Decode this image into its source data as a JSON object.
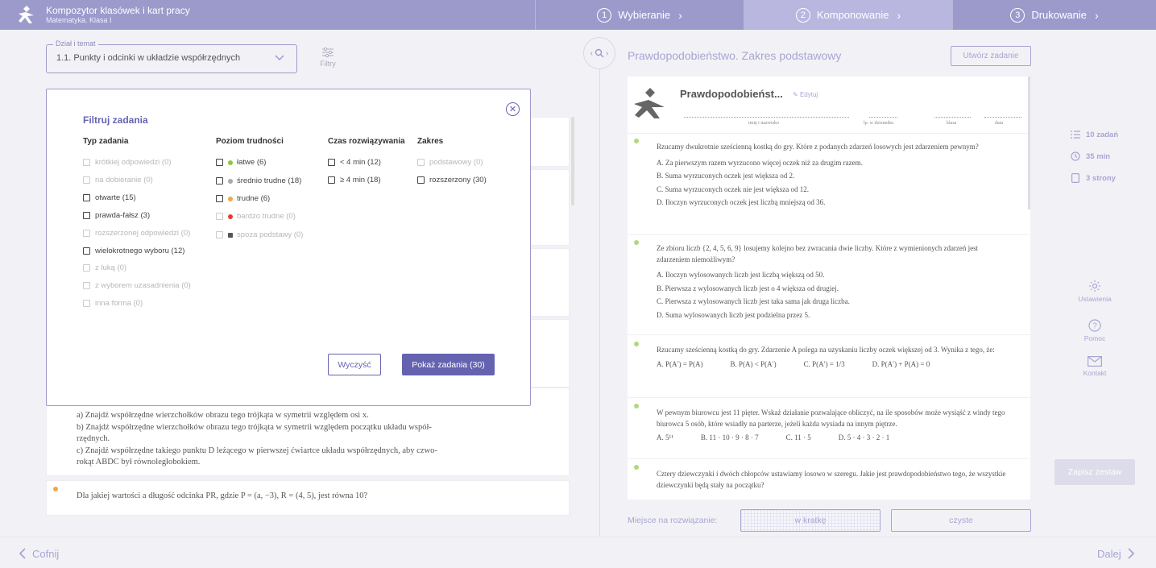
{
  "header": {
    "app_title": "Kompozytor klasówek i kart pracy",
    "app_subtitle": "Matematyka. Klasa I",
    "steps": [
      {
        "num": "1",
        "label": "Wybieranie",
        "active": false
      },
      {
        "num": "2",
        "label": "Komponowanie",
        "active": true
      },
      {
        "num": "3",
        "label": "Drukowanie",
        "active": false
      }
    ]
  },
  "topic": {
    "legend": "Dział i temat",
    "value": "1.1. Punkty i odcinki w układzie współrzędnych",
    "filters_label": "Filtry"
  },
  "tasks_behind": {
    "lines": [
      "a)  Znajdź współrzędne wierzchołków obrazu tego trójkąta w symetrii względem osi x.",
      "b)  Znajdź współrzędne wierzchołków obrazu tego trójkąta w symetrii względem początku układu współ-",
      "rzędnych.",
      "c)  Znajdź współrzędne takiego punktu D leżącego w pierwszej ćwiartce układu współrzędnych, aby czwo-",
      "rokąt ABDC był równoległobokiem."
    ],
    "next_task": "Dla jakiej wartości a długość odcinka PR, gdzie P = (a, −3), R = (4, 5), jest równa 10?"
  },
  "filter_modal": {
    "title": "Filtruj zadania",
    "columns": [
      {
        "head": "Typ zadania",
        "options": [
          {
            "label": "krótkiej odpowiedzi (0)",
            "enabled": false
          },
          {
            "label": "na dobieranie (0)",
            "enabled": false
          },
          {
            "label": "otwarte (15)",
            "enabled": true
          },
          {
            "label": "prawda-fałsz (3)",
            "enabled": true
          },
          {
            "label": "rozszerzonej odpowiedzi (0)",
            "enabled": false
          },
          {
            "label": "wielokrotnego wyboru (12)",
            "enabled": true
          },
          {
            "label": "z luką (0)",
            "enabled": false
          },
          {
            "label": "z wyborem uzasadnienia (0)",
            "enabled": false
          },
          {
            "label": "inna forma (0)",
            "enabled": false
          }
        ]
      },
      {
        "head": "Poziom trudności",
        "options": [
          {
            "label": "łatwe (6)",
            "enabled": true,
            "color": "#8dc63f"
          },
          {
            "label": "średnio trudne (18)",
            "enabled": true,
            "color": "#a9a9a9"
          },
          {
            "label": "trudne (6)",
            "enabled": true,
            "color": "#f5a742"
          },
          {
            "label": "bardzo trudne (0)",
            "enabled": false,
            "color": "#e53935"
          },
          {
            "label": "spoza podstawy (0)",
            "enabled": false,
            "color": "#555555"
          }
        ]
      },
      {
        "head": "Czas rozwiązywania",
        "options": [
          {
            "label": "< 4 min (12)",
            "enabled": true
          },
          {
            "label": "≥ 4 min (18)",
            "enabled": true
          }
        ]
      },
      {
        "head": "Zakres",
        "options": [
          {
            "label": "podstawowy (0)",
            "enabled": false
          },
          {
            "label": "rozszerzony (30)",
            "enabled": true
          }
        ]
      }
    ],
    "clear_label": "Wyczyść",
    "show_label": "Pokaż zadania (30)"
  },
  "set": {
    "title": "Prawdopodobieństwo. Zakres podstawowy",
    "create_label": "Utwórz zadanie",
    "doc_title": "Prawdopodobieńst...",
    "edit_label": "Edytuj",
    "fields": [
      "imię i nazwisko",
      "lp. w dzienniku",
      "klasa",
      "data"
    ],
    "questions": [
      {
        "text": "Rzucamy dwukrotnie sześcienną kostką do gry. Które z podanych zdarzeń losowych jest zdarzeniem pewnym?",
        "answers": [
          "A. Za pierwszym razem wyrzucono więcej oczek niż za drugim razem.",
          "B. Suma wyrzuconych oczek jest większa od 2.",
          "C. Suma wyrzuconych oczek nie jest większa od 12.",
          "D. Iloczyn wyrzuconych oczek jest liczbą mniejszą od 36."
        ]
      },
      {
        "text": "Ze zbioru liczb {2, 4, 5, 6, 9} losujemy kolejno bez zwracania dwie liczby. Które z wymienionych zdarzeń jest zdarzeniem niemożliwym?",
        "answers": [
          "A. Iloczyn wylosowanych liczb jest liczbą większą od 50.",
          "B. Pierwsza z wylosowanych liczb jest o 4 większa od drugiej.",
          "C. Pierwsza z wylosowanych liczb jest taka sama jak druga liczba.",
          "D. Suma wylosowanych liczb jest podzielna przez 5."
        ]
      },
      {
        "text": "Rzucamy sześcienną kostką do gry. Zdarzenie A polega na uzyskaniu liczby oczek większej od 3. Wynika z tego, że:",
        "answers": [
          "A. P(A′) = P(A)",
          "B. P(A) < P(A′)",
          "C. P(A′) = 1/3",
          "D. P(A′) + P(A) = 0"
        ]
      },
      {
        "text": "W pewnym biurowcu jest 11 pięter. Wskaż działanie pozwalające obliczyć, na ile sposobów może wysiąść z windy tego biurowca 5 osób, które wsiadły na parterze, jeżeli każda wysiada na innym piętrze.",
        "answers": [
          "A. 5¹¹",
          "B. 11 · 10 · 9 · 8 · 7",
          "C. 11 · 5",
          "D. 5 · 4 · 3 · 2 · 1"
        ]
      },
      {
        "text": "Cztery dziewczynki i dwóch chłopców ustawiamy losowo w szeregu. Jakie jest prawdopodobieństwo tego, że wszystkie dziewczynki będą stały na początku?",
        "answers": []
      }
    ],
    "space_label": "Miejsce na rozwiązanie:",
    "grid_label": "w kratkę",
    "clean_label": "czyste"
  },
  "stats": {
    "tasks": "10 zadań",
    "time": "35 min",
    "pages": "3 strony"
  },
  "side_links": {
    "settings": "Ustawienia",
    "help": "Pomoc",
    "contact": "Kontakt"
  },
  "save_label": "Zapisz zestaw",
  "nav": {
    "back": "Cofnij",
    "next": "Dalej"
  },
  "colors": {
    "accent": "#6563b0",
    "header": "#9c9acb",
    "muted": "#a7a5d3"
  }
}
